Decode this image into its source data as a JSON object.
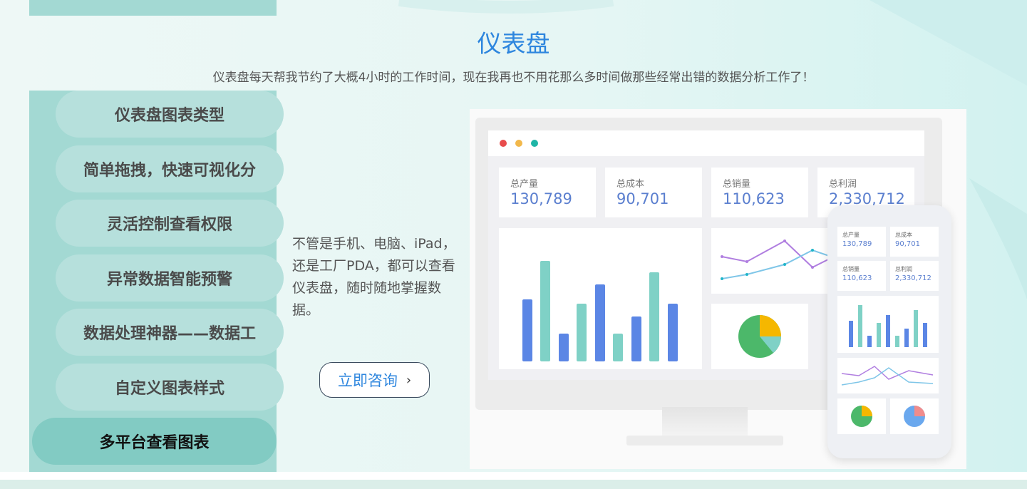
{
  "section": {
    "title": "仪表盘",
    "subtitle": "仪表盘每天帮我节约了大概4小时的工作时间，现在我再也不用花那么多时间做那些经常出错的数据分析工作了！"
  },
  "sidebar": {
    "items": [
      {
        "label": "仪表盘图表类型",
        "active": false
      },
      {
        "label": "简单拖拽，快速可视化分",
        "active": false
      },
      {
        "label": "灵活控制查看权限",
        "active": false
      },
      {
        "label": "异常数据智能预警",
        "active": false
      },
      {
        "label": "数据处理神器——数据工",
        "active": false
      },
      {
        "label": "自定义图表样式",
        "active": false
      },
      {
        "label": "多平台查看图表",
        "active": true
      }
    ]
  },
  "content": {
    "description": "不管是手机、电脑、iPad，还是工厂PDA，都可以查看仪表盘，随时随地掌握数据。",
    "button_label": "立即咨询",
    "button_icon": "chevron-right-icon"
  },
  "illustration": {
    "kpis": [
      {
        "label": "总产量",
        "value": "130,789"
      },
      {
        "label": "总成本",
        "value": "90,701"
      },
      {
        "label": "总销量",
        "value": "110,623"
      },
      {
        "label": "总利润",
        "value": "2,330,712"
      }
    ],
    "colors": {
      "bar_blue": "#5b86e5",
      "bar_teal": "#7fd1c6",
      "pie_green": "#4cb86a",
      "pie_yellow": "#f5b700",
      "accent": "#2e86de"
    }
  }
}
